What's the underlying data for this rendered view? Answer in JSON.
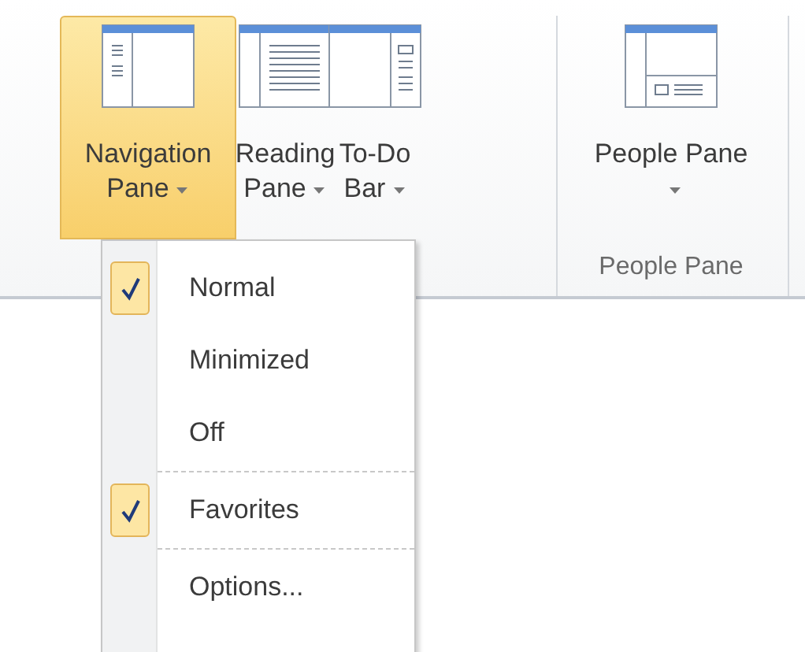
{
  "ribbon": {
    "groups": [
      {
        "buttons": [
          {
            "kind": "navigation",
            "label": "Navigation Pane",
            "selected": true
          },
          {
            "kind": "reading",
            "label": "Reading Pane",
            "selected": false
          },
          {
            "kind": "todo",
            "label": "To-Do Bar",
            "selected": false
          }
        ]
      },
      {
        "label": "People Pane",
        "buttons": [
          {
            "kind": "people",
            "label": "People Pane",
            "selected": false
          }
        ]
      }
    ]
  },
  "menu": {
    "items": [
      {
        "kind": "item",
        "label": "Normal",
        "checked": true
      },
      {
        "kind": "item",
        "label": "Minimized",
        "checked": false
      },
      {
        "kind": "item",
        "label": "Off",
        "checked": false
      },
      {
        "kind": "separator"
      },
      {
        "kind": "item",
        "label": "Favorites",
        "checked": true
      },
      {
        "kind": "separator"
      },
      {
        "kind": "item",
        "label": "Options...",
        "checked": false
      }
    ]
  }
}
